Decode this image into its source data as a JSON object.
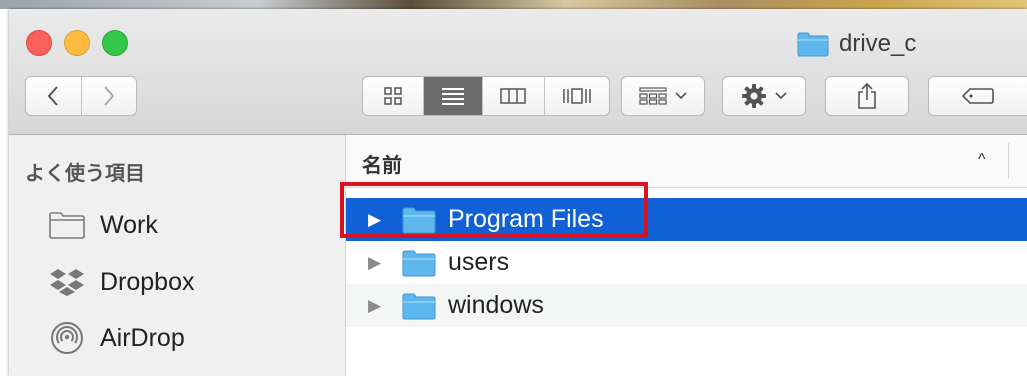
{
  "window": {
    "title": "drive_c"
  },
  "colors": {
    "selection": "#1060d6",
    "annotation": "#d9121f",
    "folder": "#5fb8ed"
  },
  "toolbar": {
    "nav_back": "back-chevron",
    "nav_forward": "forward-chevron",
    "view_modes": [
      "icon-view",
      "list-view",
      "column-view",
      "coverflow-view"
    ],
    "active_view": "list-view"
  },
  "sidebar": {
    "heading": "よく使う項目",
    "items": [
      {
        "label": "Work",
        "icon": "folder-icon"
      },
      {
        "label": "Dropbox",
        "icon": "dropbox-icon"
      },
      {
        "label": "AirDrop",
        "icon": "airdrop-icon"
      }
    ]
  },
  "list": {
    "column_name": "名前",
    "sort_indicator": "^",
    "rows": [
      {
        "name": "Program Files",
        "selected": true
      },
      {
        "name": "users",
        "selected": false
      },
      {
        "name": "windows",
        "selected": false
      }
    ]
  }
}
